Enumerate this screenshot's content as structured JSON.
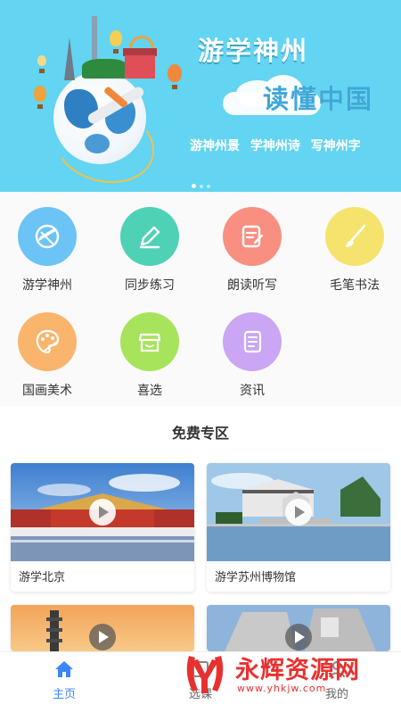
{
  "banner": {
    "title_line1": "游学神州",
    "title_line2": "读懂中国",
    "subtitles": [
      "游神州景",
      "学神州诗",
      "写神州字"
    ],
    "colors": {
      "background": "#63d4f1",
      "title2": "#3fa7d8"
    }
  },
  "menu": {
    "items": [
      {
        "label": "游学神州",
        "icon": "globe-plane-icon",
        "color": "#6cc3f5"
      },
      {
        "label": "同步练习",
        "icon": "pencil-icon",
        "color": "#4fd1b5"
      },
      {
        "label": "朗读听写",
        "icon": "document-edit-icon",
        "color": "#f98f80"
      },
      {
        "label": "毛笔书法",
        "icon": "brush-icon",
        "color": "#f6e36e"
      },
      {
        "label": "国画美术",
        "icon": "palette-icon",
        "color": "#f9b56c"
      },
      {
        "label": "喜选",
        "icon": "shop-icon",
        "color": "#a8e35c"
      },
      {
        "label": "资讯",
        "icon": "news-icon",
        "color": "#caa6f4"
      }
    ]
  },
  "free_section": {
    "title": "免费专区",
    "cards": [
      {
        "caption": "游学北京",
        "thumb": "forbidden-city"
      },
      {
        "caption": "游学苏州博物馆",
        "thumb": "suzhou-museum"
      },
      {
        "caption": "",
        "thumb": "taipei-101"
      },
      {
        "caption": "",
        "thumb": "memorial-monument"
      }
    ]
  },
  "tabbar": {
    "tabs": [
      {
        "label": "主页",
        "icon": "home-icon",
        "active": true
      },
      {
        "label": "选课",
        "icon": "course-icon",
        "active": false
      },
      {
        "label": "我的",
        "icon": "user-icon",
        "active": false
      }
    ],
    "active_color": "#3d86f7"
  },
  "watermark": {
    "text": "永辉资源网",
    "url": "www.yhkjw.com"
  }
}
